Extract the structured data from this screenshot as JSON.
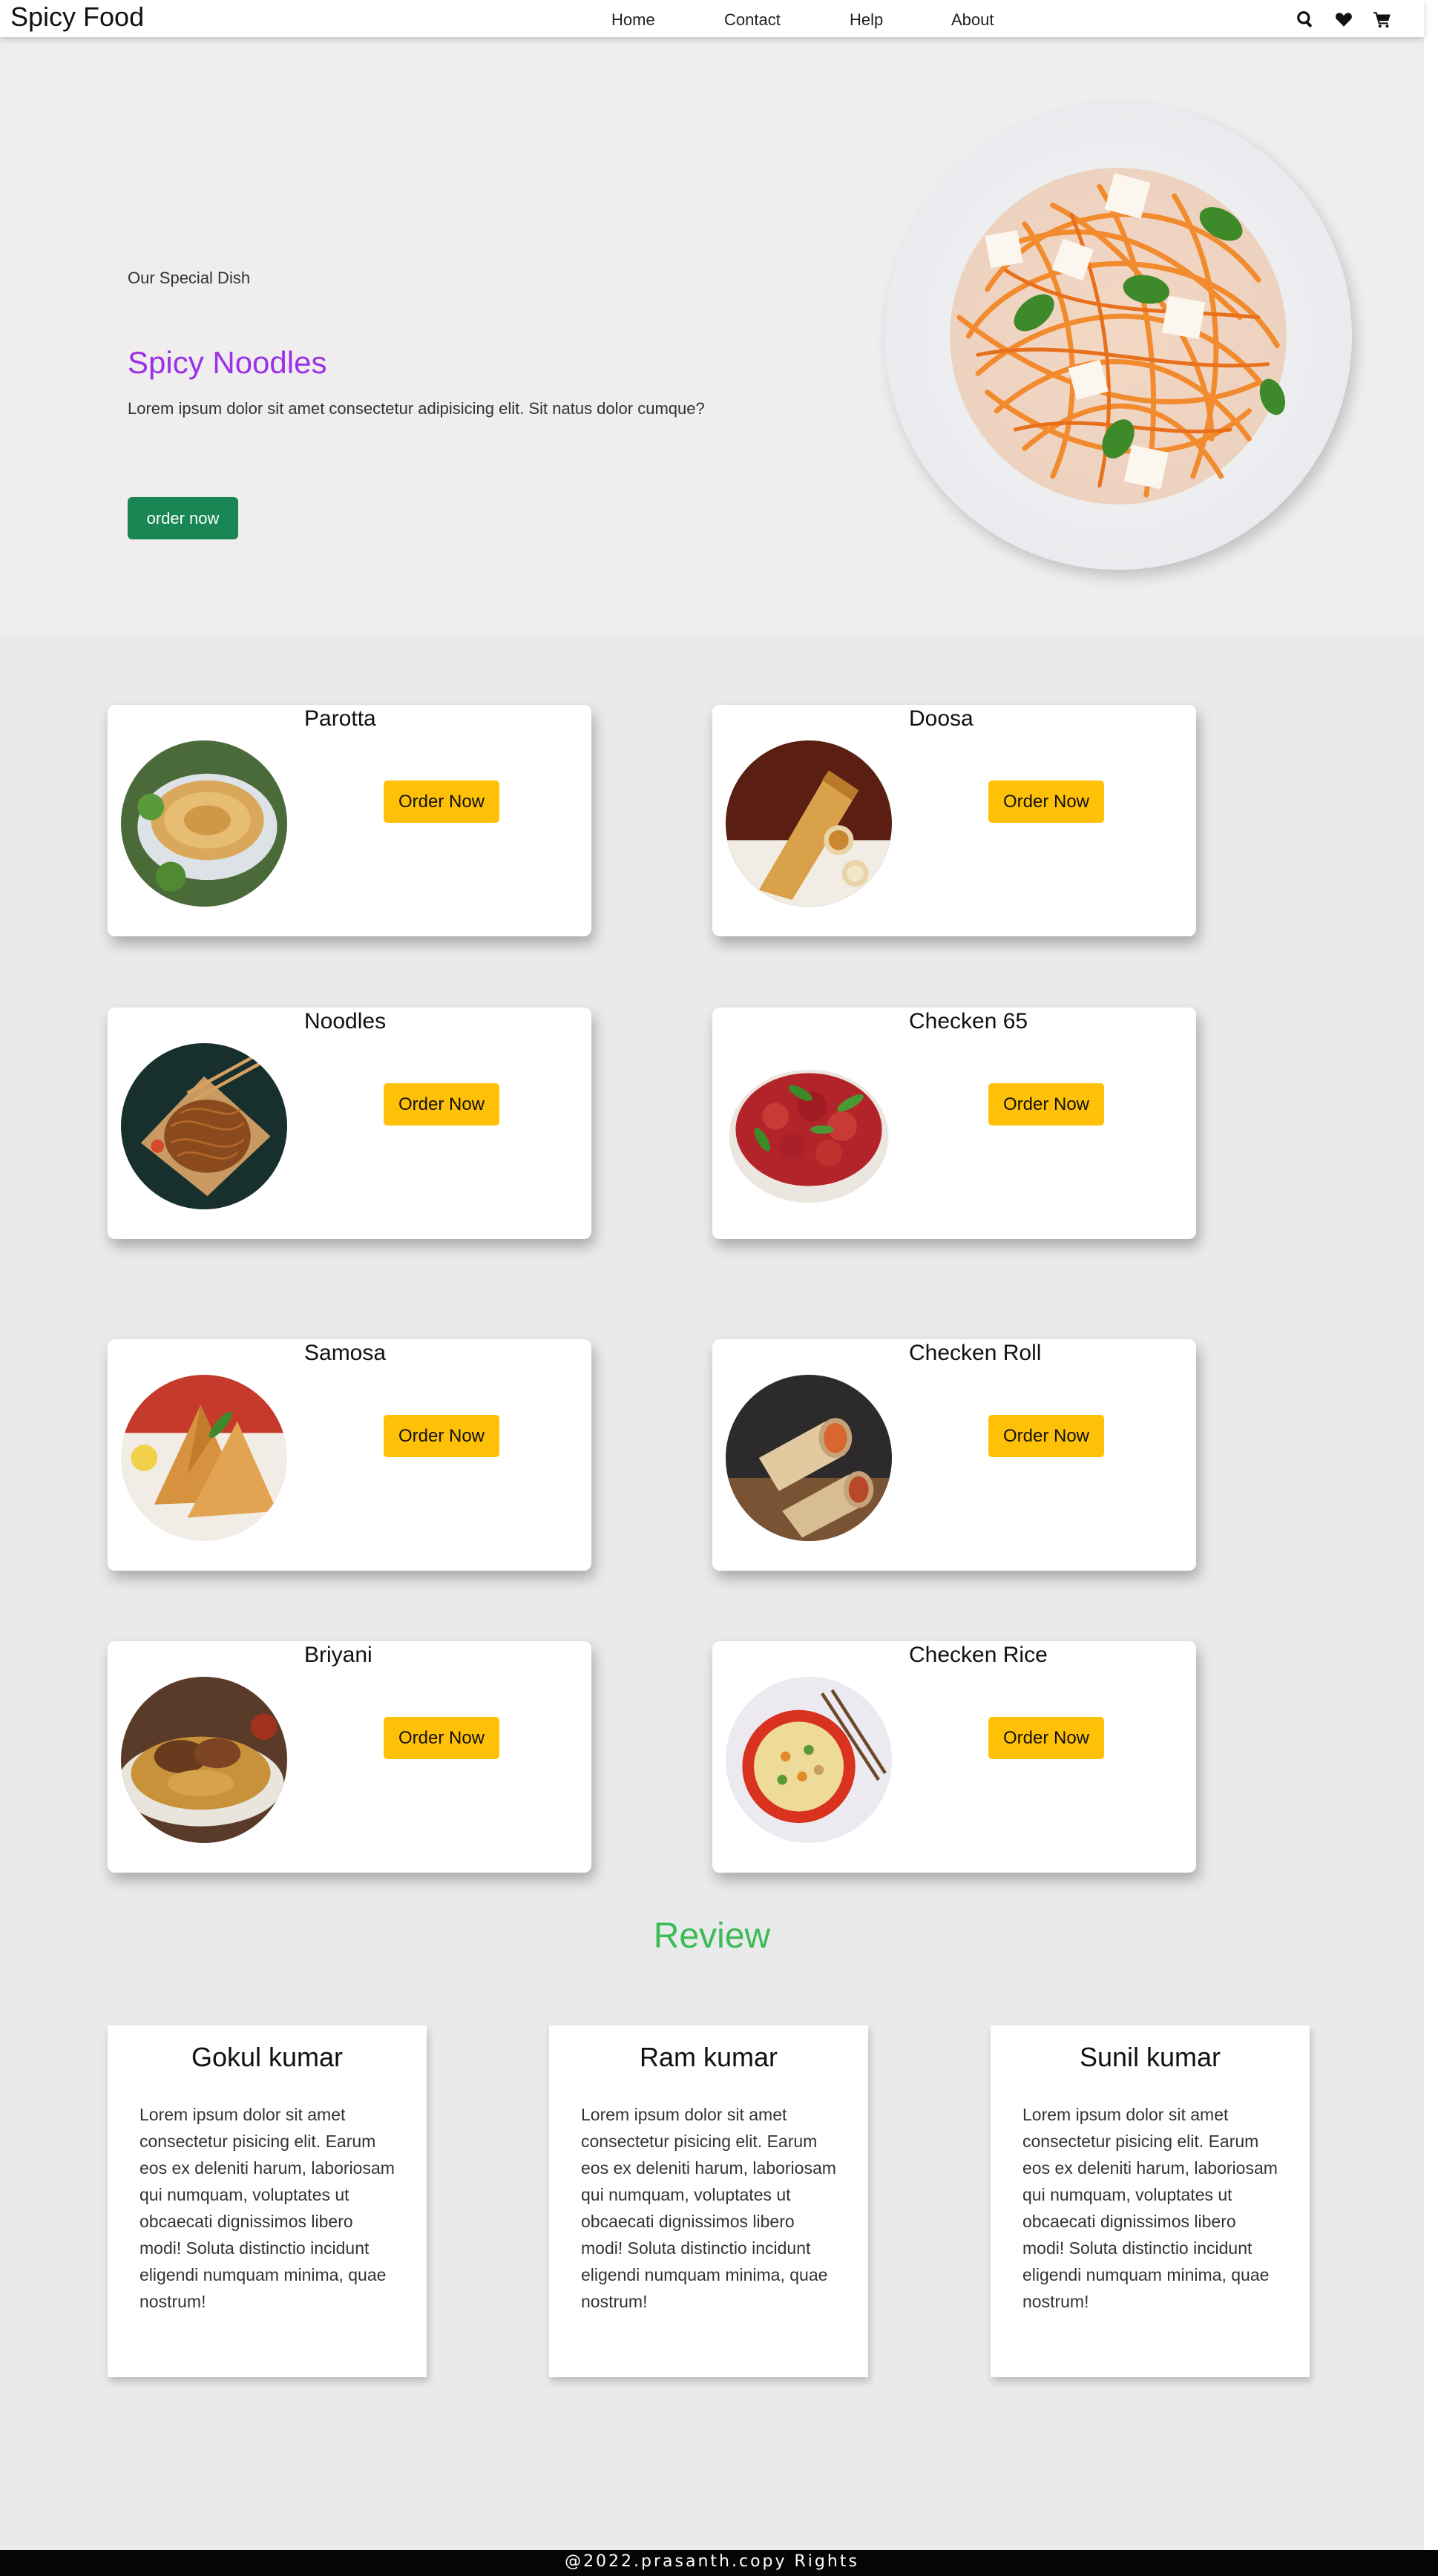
{
  "navbar": {
    "brand": "Spicy Food",
    "links": [
      "Home",
      "Contact",
      "Help",
      "About"
    ],
    "icons": [
      "search-icon",
      "heart-icon",
      "cart-icon"
    ]
  },
  "hero": {
    "subtitle": "Our Special Dish",
    "title": "Spicy Noodles",
    "description": "Lorem ipsum dolor sit amet consectetur adipisicing elit. Sit natus dolor cumque?",
    "button": "order now",
    "accent_color": "#9b30e8",
    "button_color": "#198754"
  },
  "menu": {
    "items": [
      {
        "name": "Parotta",
        "button": "Order Now",
        "image": "parotta-image"
      },
      {
        "name": "Doosa",
        "button": "Order Now",
        "image": "dosa-image"
      },
      {
        "name": "Noodles",
        "button": "Order Now",
        "image": "noodles-image"
      },
      {
        "name": "Checken 65",
        "button": "Order Now",
        "image": "chicken-65-image"
      },
      {
        "name": "Samosa",
        "button": "Order Now",
        "image": "samosa-image"
      },
      {
        "name": "Checken Roll",
        "button": "Order Now",
        "image": "chicken-roll-image"
      },
      {
        "name": "Briyani",
        "button": "Order Now",
        "image": "biryani-image"
      },
      {
        "name": "Checken Rice",
        "button": "Order Now",
        "image": "chicken-rice-image"
      }
    ],
    "button_color": "#ffc107"
  },
  "review": {
    "title": "Review",
    "title_color": "#3cba54",
    "items": [
      {
        "name": "Gokul kumar",
        "text": "Lorem ipsum dolor sit amet consectetur pisicing elit. Earum eos ex deleniti harum, laboriosam qui numquam, voluptates ut obcaecati dignissimos libero modi! Soluta distinctio incidunt eligendi numquam minima, quae nostrum!"
      },
      {
        "name": "Ram kumar",
        "text": "Lorem ipsum dolor sit amet consectetur pisicing elit. Earum eos ex deleniti harum, laboriosam qui numquam, voluptates ut obcaecati dignissimos libero modi! Soluta distinctio incidunt eligendi numquam minima, quae nostrum!"
      },
      {
        "name": "Sunil kumar",
        "text": "Lorem ipsum dolor sit amet consectetur pisicing elit. Earum eos ex deleniti harum, laboriosam qui numquam, voluptates ut obcaecati dignissimos libero modi! Soluta distinctio incidunt eligendi numquam minima, quae nostrum!"
      }
    ]
  },
  "footer": {
    "text": "@2022.prasanth.copy Rights"
  }
}
